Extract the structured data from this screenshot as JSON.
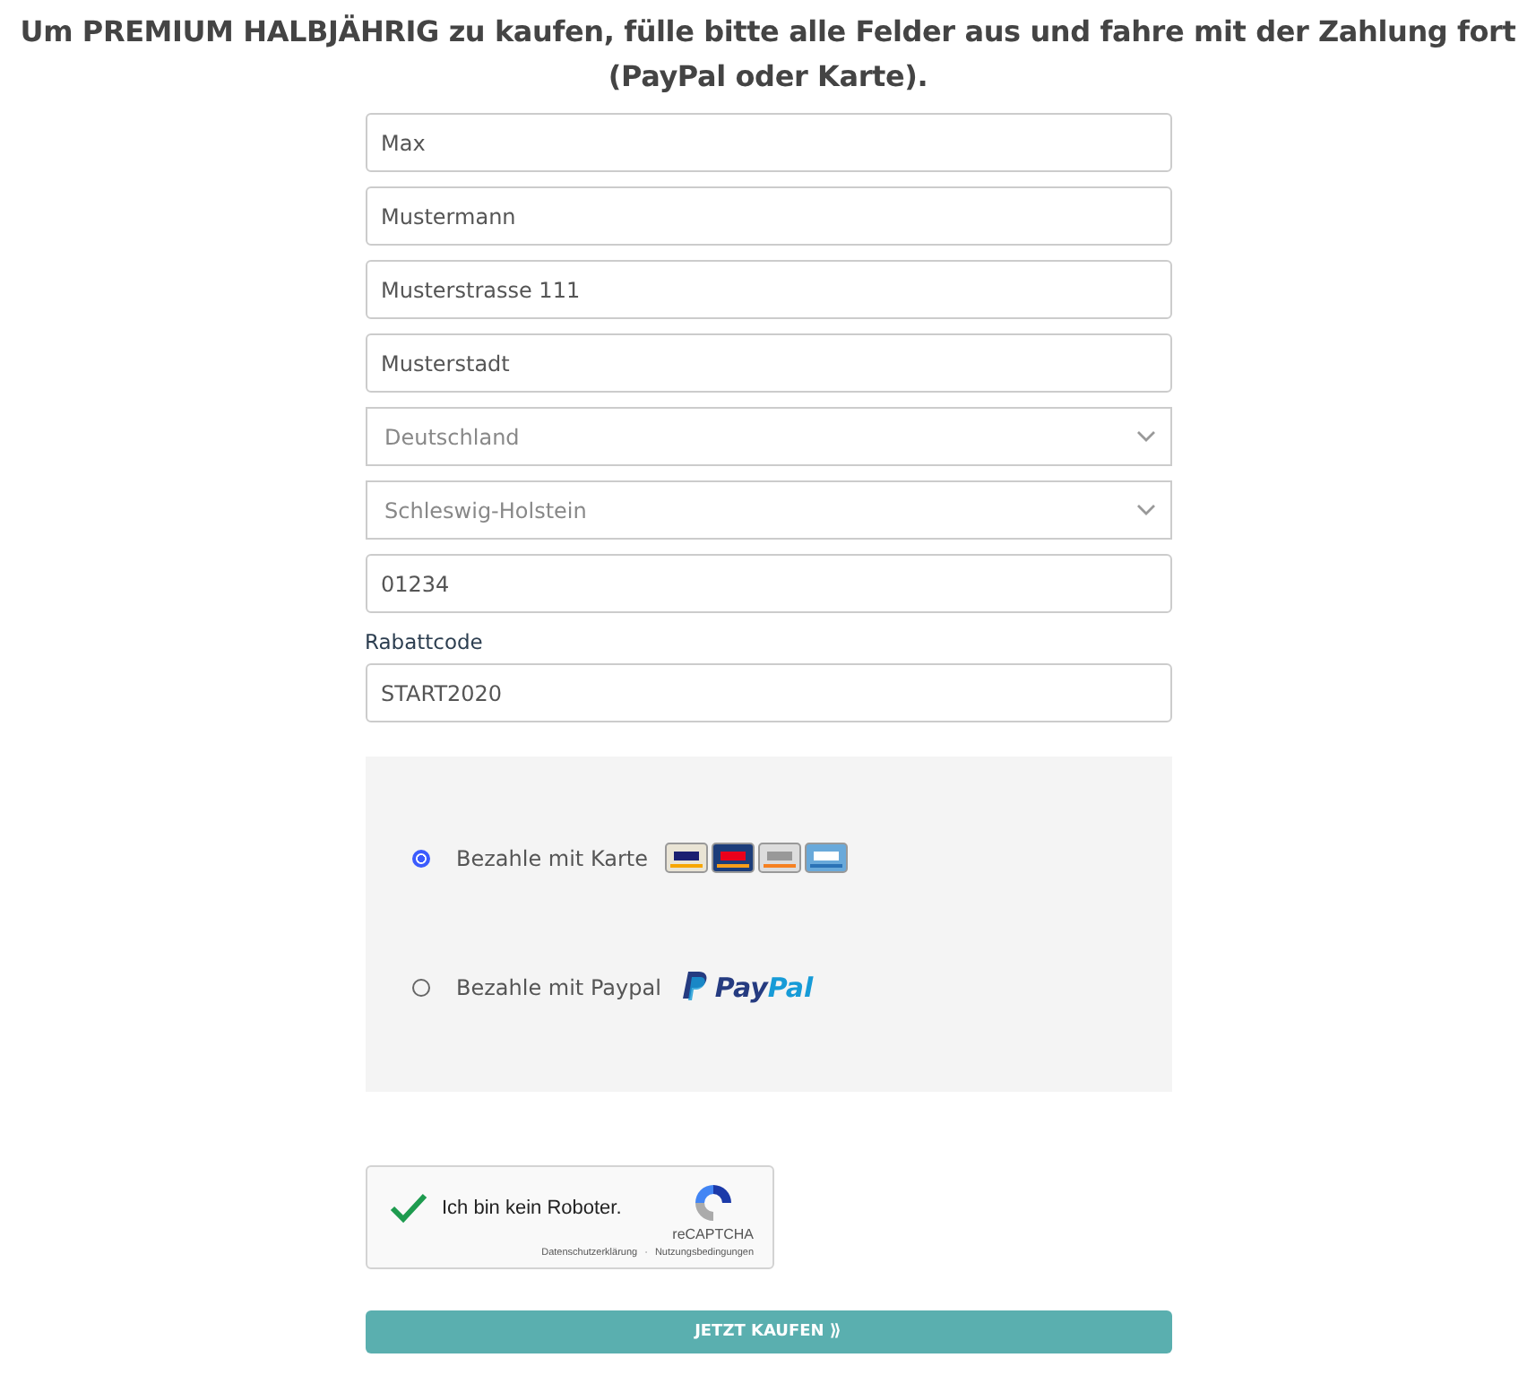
{
  "heading": "Um PREMIUM HALBJÄHRIG zu kaufen, fülle bitte alle Felder aus und fahre mit der Zahlung fort (PayPal oder Karte).",
  "fields": [
    {
      "kind": "input",
      "value": "Max"
    },
    {
      "kind": "input",
      "value": "Mustermann"
    },
    {
      "kind": "input",
      "value": "Musterstrasse 111"
    },
    {
      "kind": "input",
      "value": "Musterstadt"
    },
    {
      "kind": "select",
      "value": "Deutschland"
    },
    {
      "kind": "select",
      "value": "Schleswig-Holstein"
    },
    {
      "kind": "input",
      "value": "01234"
    },
    {
      "kind": "input",
      "label": "Rabattcode",
      "value": "START2020"
    }
  ],
  "payment_options": [
    {
      "kind": "card",
      "label": "Bezahle mit Karte",
      "selected": true
    },
    {
      "kind": "paypal",
      "label": "Bezahle mit Paypal",
      "logo_text": "PayPal",
      "selected": false
    }
  ],
  "captcha": {
    "label": "Ich bin kein Roboter.",
    "checked": true,
    "brand": "reCAPTCHA",
    "links": [
      "Datenschutzerklärung",
      "Nutzungsbedingungen"
    ],
    "separator": "·"
  },
  "submit_button": "JETZT KAUFEN ⟫"
}
